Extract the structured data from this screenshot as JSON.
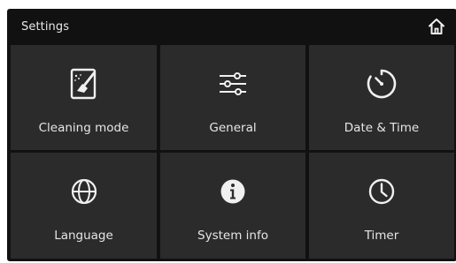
{
  "header": {
    "title": "Settings",
    "home_icon": "home-icon"
  },
  "tiles": [
    {
      "label": "Cleaning mode",
      "icon": "cleaning-tablet-icon"
    },
    {
      "label": "General",
      "icon": "sliders-icon"
    },
    {
      "label": "Date & Time",
      "icon": "date-time-icon"
    },
    {
      "label": "Language",
      "icon": "globe-icon"
    },
    {
      "label": "System info",
      "icon": "info-icon"
    },
    {
      "label": "Timer",
      "icon": "clock-icon"
    }
  ],
  "colors": {
    "background": "#111111",
    "tile": "#2c2b2b",
    "text": "#e6e6e6"
  }
}
